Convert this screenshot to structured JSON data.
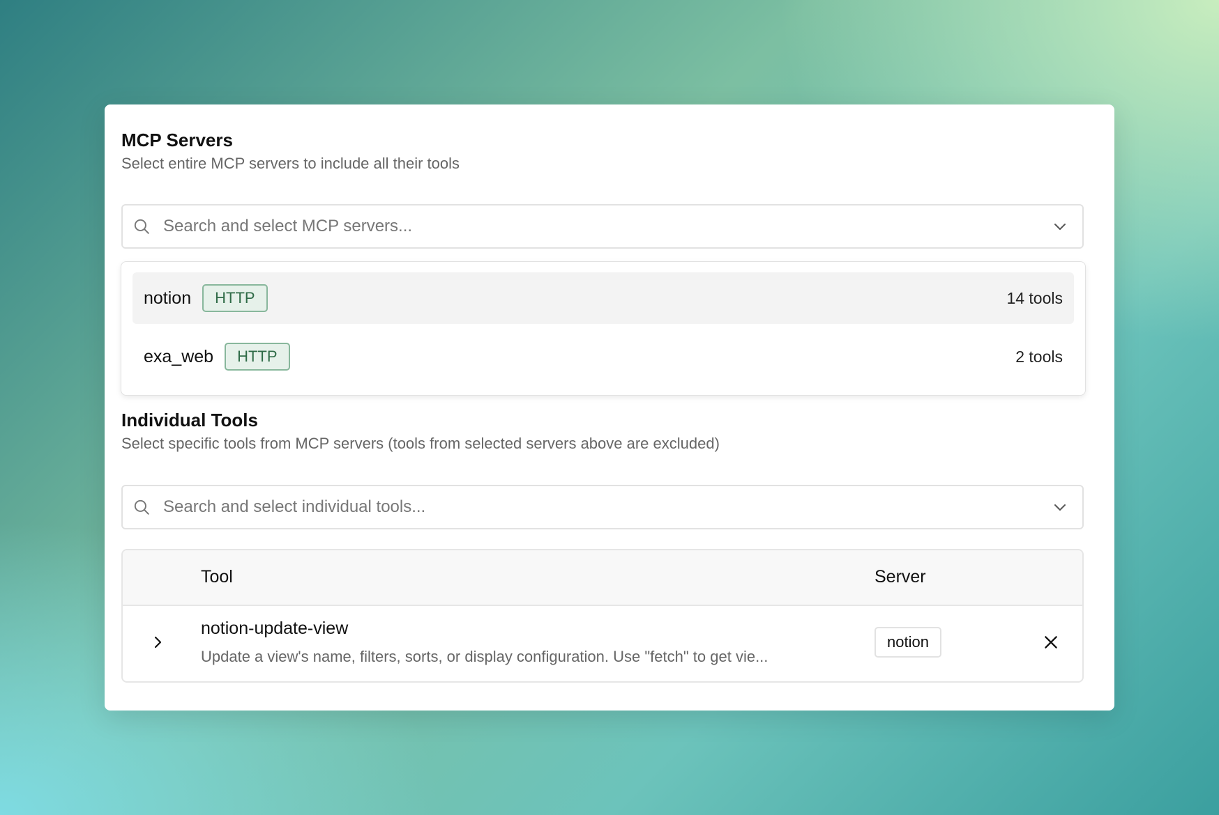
{
  "mcp_servers": {
    "title": "MCP Servers",
    "description": "Select entire MCP servers to include all their tools",
    "search_placeholder": "Search and select MCP servers...",
    "options": [
      {
        "name": "notion",
        "transport": "HTTP",
        "tool_count": "14 tools",
        "highlighted": true
      },
      {
        "name": "exa_web",
        "transport": "HTTP",
        "tool_count": "2 tools",
        "highlighted": false
      }
    ]
  },
  "individual_tools": {
    "title": "Individual Tools",
    "description": "Select specific tools from MCP servers (tools from selected servers above are excluded)",
    "search_placeholder": "Search and select individual tools...",
    "table": {
      "headers": {
        "tool": "Tool",
        "server": "Server"
      },
      "rows": [
        {
          "name": "notion-update-view",
          "description": "Update a view's name, filters, sorts, or display configuration. Use \"fetch\" to get vie...",
          "server": "notion"
        }
      ]
    }
  },
  "colors": {
    "badge_border": "#88b79c",
    "badge_bg": "#e6f1ea",
    "badge_text": "#2f6b47"
  }
}
